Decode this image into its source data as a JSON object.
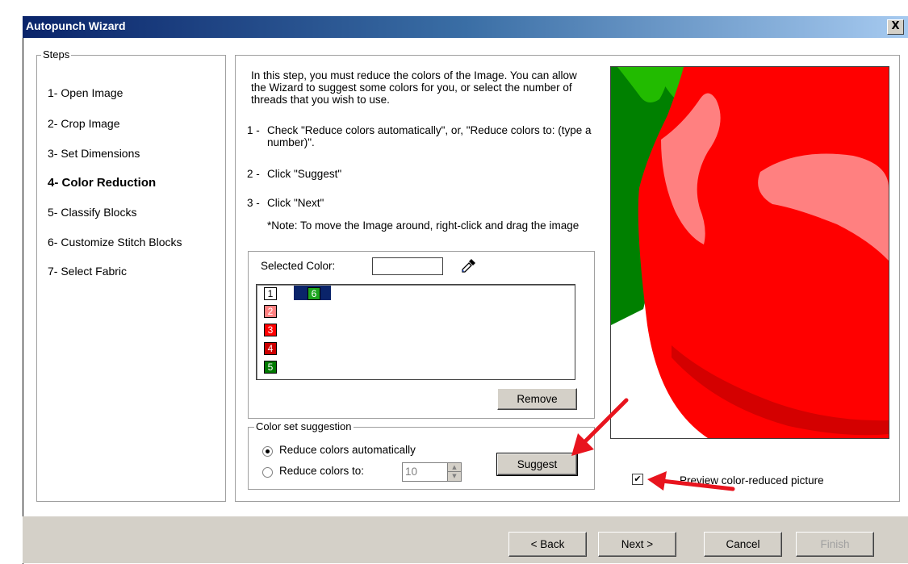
{
  "window": {
    "title": "Autopunch Wizard",
    "close_label": "X"
  },
  "steps": {
    "legend": "Steps",
    "items": [
      {
        "label": "1- Open Image",
        "active": false
      },
      {
        "label": "2- Crop Image",
        "active": false
      },
      {
        "label": "3- Set Dimensions",
        "active": false
      },
      {
        "label": "4- Color Reduction",
        "active": true
      },
      {
        "label": "5- Classify Blocks",
        "active": false
      },
      {
        "label": "6- Customize Stitch Blocks",
        "active": false
      },
      {
        "label": "7- Select Fabric",
        "active": false
      }
    ]
  },
  "instructions": {
    "intro": "In this step, you must reduce the colors of the Image. You can allow the Wizard to suggest some colors for you, or select the number of threads that you wish to use.",
    "step1_num": "1 -",
    "step1_text": "Check \"Reduce colors automatically\", or, \"Reduce colors to: (type a number)\".",
    "step2_num": "2 -",
    "step2_text": "Click \"Suggest\"",
    "step3_num": "3 -",
    "step3_text": "Click \"Next\"",
    "note": "*Note: To move the Image around, right-click and drag the image"
  },
  "colors": {
    "selected_label": "Selected Color:",
    "selected_value": "",
    "eyedropper_icon": "eyedropper-icon",
    "swatches": [
      {
        "num": "1",
        "color": "#ffffff",
        "text_color": "#000000"
      },
      {
        "num": "6",
        "color": "#1ea51e",
        "text_color": "#ffffff",
        "selected": true
      },
      {
        "num": "2",
        "color": "#ff8080",
        "text_color": "#ffffff"
      },
      {
        "num": "3",
        "color": "#ff0000",
        "text_color": "#ffffff"
      },
      {
        "num": "4",
        "color": "#cc0000",
        "text_color": "#ffffff"
      },
      {
        "num": "5",
        "color": "#007a00",
        "text_color": "#ffffff"
      }
    ],
    "remove_label": "Remove"
  },
  "suggestion": {
    "legend": "Color set suggestion",
    "auto_label": "Reduce colors automatically",
    "auto_checked": true,
    "to_label": "Reduce colors to:",
    "to_checked": false,
    "to_value": "10",
    "suggest_label": "Suggest"
  },
  "preview": {
    "checkbox_label": "Preview color-reduced picture",
    "checked": true,
    "palette": {
      "green_dark": "#008000",
      "green_light": "#22bb00",
      "red": "#ff0000",
      "red_dark": "#d40000",
      "pink": "#ff8080"
    }
  },
  "footer": {
    "back": "< Back",
    "next": "Next >",
    "cancel": "Cancel",
    "finish": "Finish"
  },
  "annotations": {
    "arrow_color": "#e8141e"
  }
}
